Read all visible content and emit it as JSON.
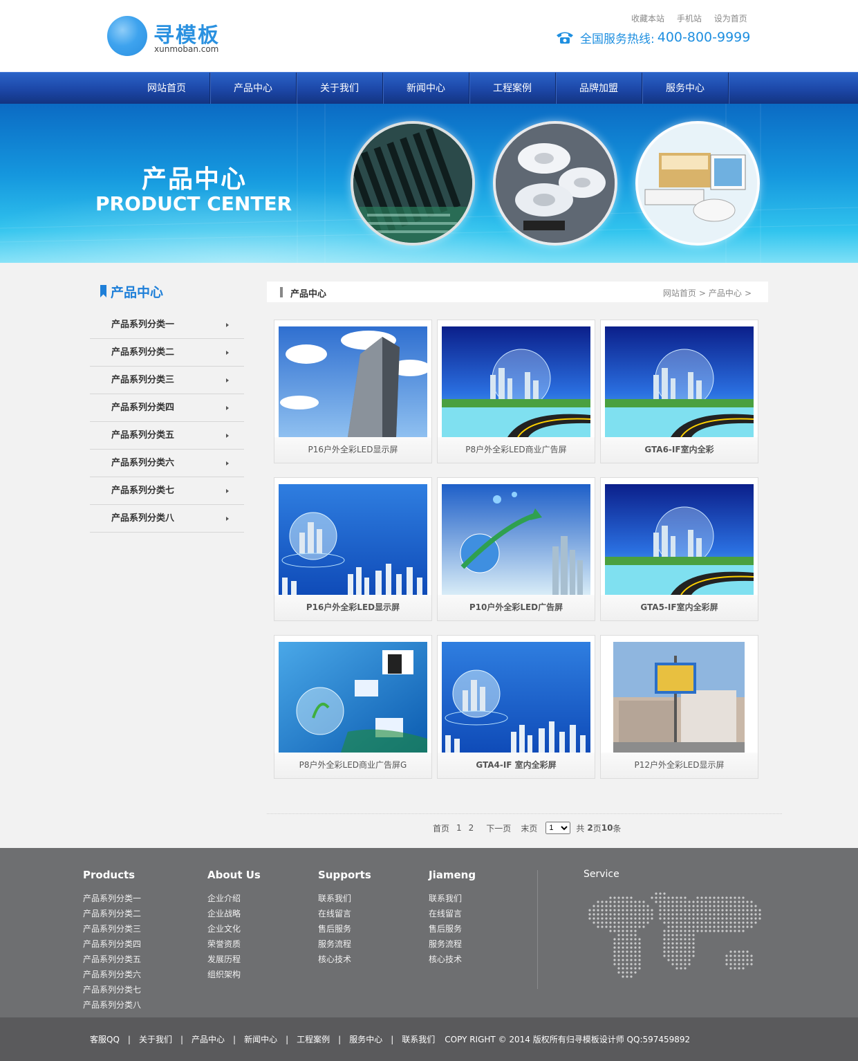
{
  "header": {
    "logo_cn": "寻模板",
    "logo_en": "xunmoban.com",
    "top_links": [
      "收藏本站",
      "手机站",
      "设为首页"
    ],
    "hotline_label": "全国服务热线:",
    "hotline_number": "400-800-9999",
    "accent_color": "#1e8fe0"
  },
  "nav": {
    "items": [
      "网站首页",
      "产品中心",
      "关于我们",
      "新闻中心",
      "工程案例",
      "品牌加盟",
      "服务中心"
    ]
  },
  "banner": {
    "title_cn": "产品中心",
    "title_en": "PRODUCT CENTER"
  },
  "sidebar": {
    "title": "产品中心",
    "items": [
      "产品系列分类一",
      "产品系列分类二",
      "产品系列分类三",
      "产品系列分类四",
      "产品系列分类五",
      "产品系列分类六",
      "产品系列分类七",
      "产品系列分类八"
    ]
  },
  "breadcrumb": {
    "title": "产品中心",
    "path": [
      "网站首页",
      "产品中心"
    ],
    "separator": ">"
  },
  "products": [
    {
      "caption": "P16户外全彩LED显示屏",
      "image": "skyscraper-sky"
    },
    {
      "caption": "P8户外全彩LED商业广告屏",
      "image": "city-globe-road"
    },
    {
      "caption": "GTA6-IF室内全彩",
      "image": "city-globe-road"
    },
    {
      "caption": "P16户外全彩LED显示屏",
      "image": "globe-city-blue"
    },
    {
      "caption": "P10户外全彩LED广告屏",
      "image": "globe-arrow-city"
    },
    {
      "caption": "GTA5-IF室内全彩屏",
      "image": "city-globe-road"
    },
    {
      "caption": "P8户外全彩LED商业广告屏G",
      "image": "business-globe"
    },
    {
      "caption": "GTA4-IF 室内全彩屏",
      "image": "globe-city-blue"
    },
    {
      "caption": "P12户外全彩LED显示屏",
      "image": "street-billboard"
    }
  ],
  "pager": {
    "first": "首页",
    "pages": [
      "1",
      "2"
    ],
    "next": "下一页",
    "last": "末页",
    "select_value": "1",
    "total_prefix": "共",
    "total_pages": "2",
    "pages_word": "页",
    "total_items": "10",
    "items_word": "条"
  },
  "footer": {
    "columns": [
      {
        "title": "Products",
        "items": [
          "产品系列分类一",
          "产品系列分类二",
          "产品系列分类三",
          "产品系列分类四",
          "产品系列分类五",
          "产品系列分类六",
          "产品系列分类七",
          "产品系列分类八"
        ]
      },
      {
        "title": "About Us",
        "items": [
          "企业介绍",
          "企业战略",
          "企业文化",
          "荣誉资质",
          "发展历程",
          "组织架构"
        ]
      },
      {
        "title": "Supports",
        "items": [
          "联系我们",
          "在线留言",
          "售后服务",
          "服务流程",
          "核心技术"
        ]
      },
      {
        "title": "Jiameng",
        "items": [
          "联系我们",
          "在线留言",
          "售后服务",
          "服务流程",
          "核心技术"
        ]
      }
    ],
    "service_title": "Service"
  },
  "bottom": {
    "links": [
      "客服QQ",
      "关于我们",
      "产品中心",
      "新闻中心",
      "工程案例",
      "服务中心",
      "联系我们"
    ],
    "separator": "|",
    "copyright": "COPY RIGHT © 2014 版权所有归寻模板设计师 QQ:597459892"
  }
}
